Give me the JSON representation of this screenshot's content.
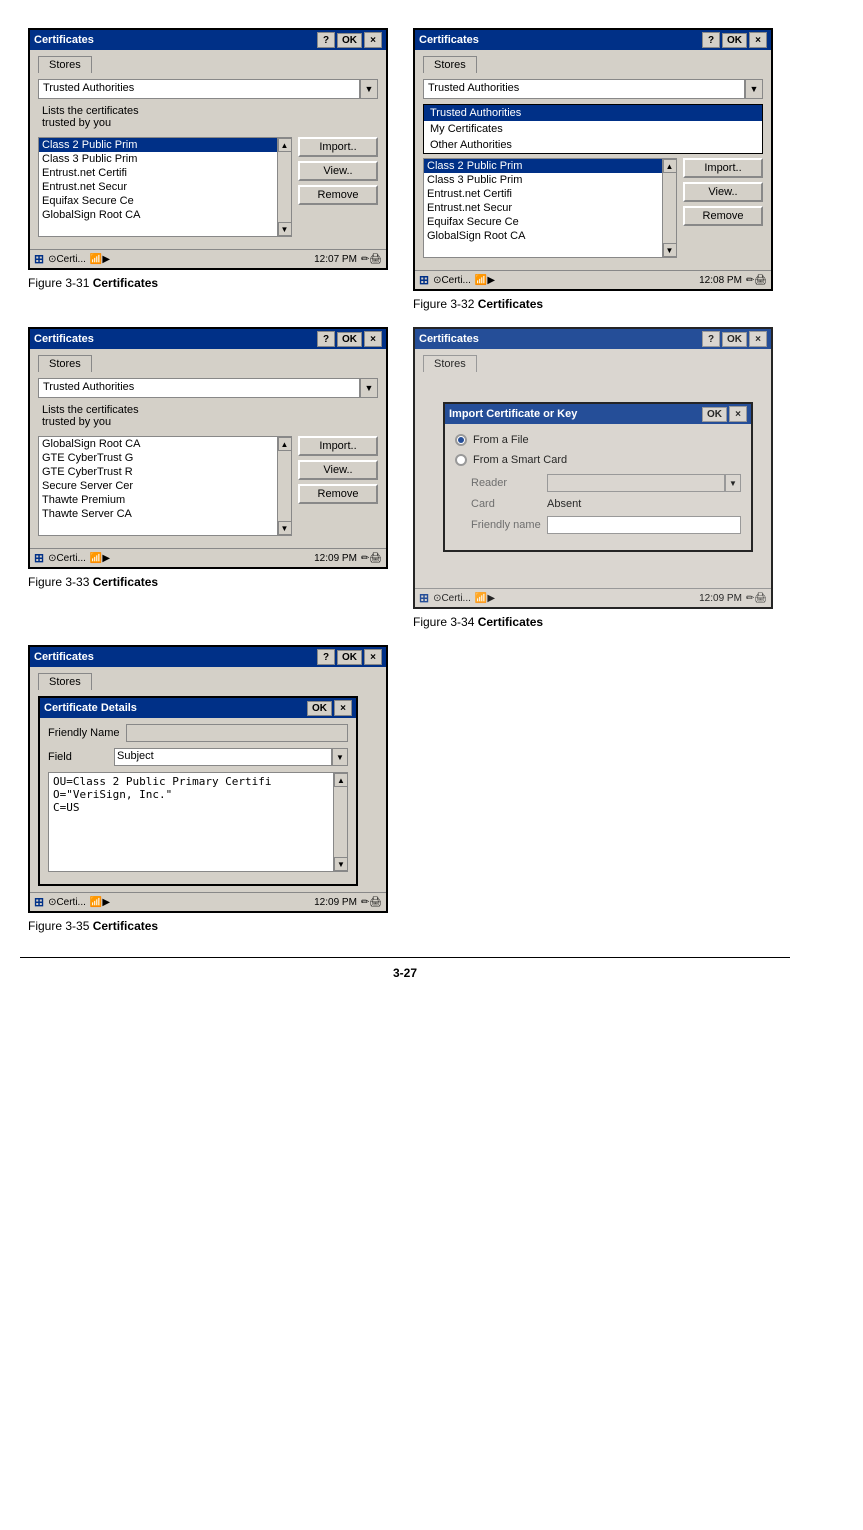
{
  "figures": {
    "fig31": {
      "caption_number": "Figure 3-31",
      "caption_bold": "Certificates",
      "dialog": {
        "title": "Certificates",
        "stores_tab": "Stores",
        "dropdown_value": "Trusted Authorities",
        "description_line1": "Lists the certificates",
        "description_line2": "trusted by you",
        "cert_list": [
          {
            "label": "Class 2 Public Prim",
            "selected": true
          },
          {
            "label": "Class 3 Public Prim",
            "selected": false
          },
          {
            "label": "Entrust.net Certifi",
            "selected": false
          },
          {
            "label": "Entrust.net Secur",
            "selected": false
          },
          {
            "label": "Equifax Secure Ce",
            "selected": false
          },
          {
            "label": "GlobalSign Root CA",
            "selected": false
          }
        ],
        "btn_import": "Import..",
        "btn_view": "View..",
        "btn_remove": "Remove",
        "status_time": "12:07 PM"
      }
    },
    "fig32": {
      "caption_number": "Figure 3-32",
      "caption_bold": "Certificates",
      "dialog": {
        "title": "Certificates",
        "stores_tab": "Stores",
        "dropdown_value": "Trusted Authorities",
        "dropdown_open": true,
        "dropdown_items": [
          {
            "label": "Trusted Authorities",
            "selected": true
          },
          {
            "label": "My Certificates",
            "selected": false
          },
          {
            "label": "Other Authorities",
            "selected": false
          }
        ],
        "cert_list": [
          {
            "label": "Class 2 Public Prim",
            "selected": true
          },
          {
            "label": "Class 3 Public Prim",
            "selected": false
          },
          {
            "label": "Entrust.net Certifi",
            "selected": false
          },
          {
            "label": "Entrust.net Secur",
            "selected": false
          },
          {
            "label": "Equifax Secure Ce",
            "selected": false
          },
          {
            "label": "GlobalSign Root CA",
            "selected": false
          }
        ],
        "btn_import": "Import..",
        "btn_view": "View..",
        "btn_remove": "Remove",
        "status_time": "12:08 PM"
      }
    },
    "fig33": {
      "caption_number": "Figure 3-33",
      "caption_bold": "Certificates",
      "dialog": {
        "title": "Certificates",
        "stores_tab": "Stores",
        "dropdown_value": "Trusted Authorities",
        "description_line1": "Lists the certificates",
        "description_line2": "trusted by you",
        "cert_list": [
          {
            "label": "GlobalSign Root CA",
            "selected": false
          },
          {
            "label": "GTE CyberTrust G",
            "selected": false
          },
          {
            "label": "GTE CyberTrust R",
            "selected": false
          },
          {
            "label": "Secure Server Cer",
            "selected": false
          },
          {
            "label": "Thawte Premium",
            "selected": false
          },
          {
            "label": "Thawte Server CA",
            "selected": false
          }
        ],
        "btn_import": "Import..",
        "btn_view": "View..",
        "btn_remove": "Remove",
        "status_time": "12:09 PM"
      }
    },
    "fig34": {
      "caption_number": "Figure 3-34",
      "caption_bold": "Certificates",
      "outer_dialog": {
        "title": "Certificates",
        "stores_tab": "Stores"
      },
      "import_dialog": {
        "title": "Import Certificate or Key",
        "radio1": "From a File",
        "radio1_checked": true,
        "radio2": "From a Smart Card",
        "radio2_checked": false,
        "label_reader": "Reader",
        "label_card": "Card",
        "card_value": "Absent",
        "label_friendly_name": "Friendly name",
        "friendly_name_value": ""
      },
      "status_time": "12:09 PM"
    },
    "fig35": {
      "caption_number": "Figure 3-35",
      "caption_bold": "Certificates",
      "dialog": {
        "title": "Certificates",
        "stores_tab": "Stores",
        "inner_dialog": {
          "title": "Certificate Details",
          "label_friendly_name": "Friendly Name",
          "friendly_name_value": "",
          "label_field": "Field",
          "field_value": "Subject",
          "textarea_content": "OU=Class 2 Public Primary Certifi\nO=\"VeriSign, Inc.\"\nC=US"
        },
        "status_time": "12:09 PM"
      }
    }
  },
  "page_number": "3-27",
  "icons": {
    "question": "?",
    "ok": "OK",
    "close": "×",
    "dropdown_arrow": "▼",
    "scroll_up": "▲",
    "scroll_down": "▼",
    "windows_logo": "⊞",
    "radio_checked": "●",
    "radio_unchecked": "○"
  }
}
